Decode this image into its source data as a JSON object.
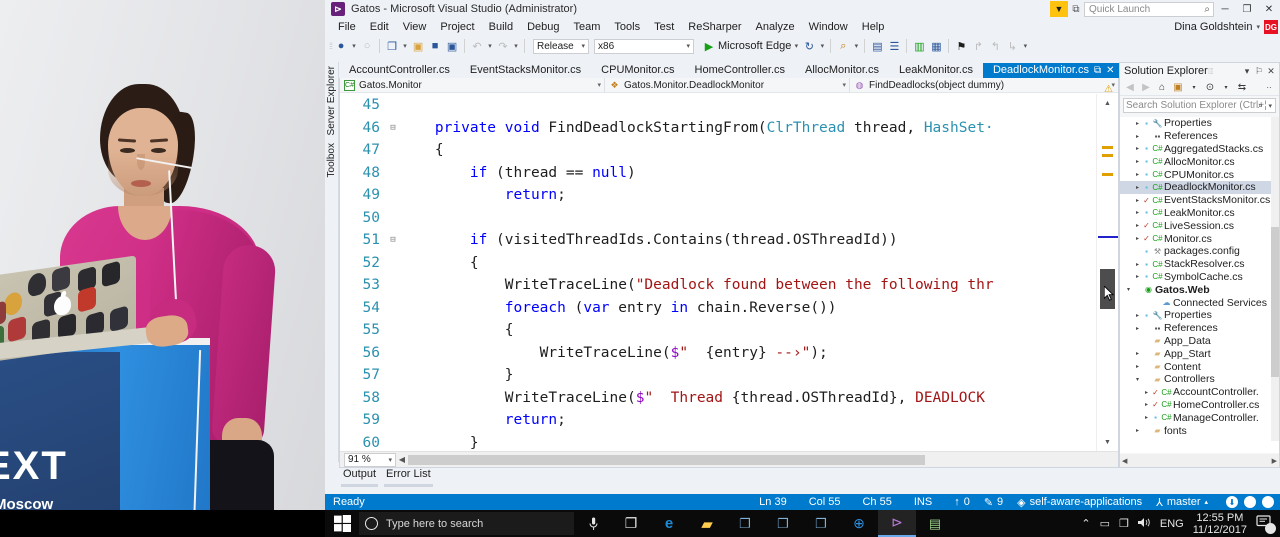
{
  "video": {
    "name": "conference-video-feed",
    "podium_text": "EXT",
    "podium_sub": "Moscow",
    "podium_chev": "/"
  },
  "window": {
    "title": "Gatos - Microsoft Visual Studio (Administrator)",
    "logo_glyph": "⊳",
    "minimize": "─",
    "restore": "❐",
    "close": "✕",
    "feedback_icon": "feedback-icon",
    "feedback_glyph": "▼",
    "screenshot_glyph": "⧉"
  },
  "quick_launch": {
    "placeholder": "Quick Launch",
    "magnifier": "⌕"
  },
  "menu": {
    "items": [
      "File",
      "Edit",
      "View",
      "Project",
      "Build",
      "Debug",
      "Team",
      "Tools",
      "Test",
      "ReSharper",
      "Analyze",
      "Window",
      "Help"
    ]
  },
  "user": {
    "name": "Dina Goldshtein",
    "caret": "▾",
    "initials": "DG"
  },
  "toolbar": {
    "navigate_back": "●",
    "navigate_forward": "○",
    "new_project": "❐",
    "open_file": "▣",
    "save": "■",
    "save_all": "▣",
    "undo": "↶",
    "redo": "↷",
    "config": "Release",
    "platform": "x86",
    "start_glyph": "▶",
    "start_label": "Microsoft Edge",
    "refresh": "↻",
    "caret": "▾",
    "find_glyph": "⌕",
    "extra_icons": [
      "▤",
      "☰",
      "▥",
      "▦",
      "⚑",
      "↱",
      "↰",
      "↳"
    ]
  },
  "side_tabs": [
    "Server Explorer",
    "Toolbox"
  ],
  "document_tabs": [
    {
      "label": "AccountController.cs",
      "active": false
    },
    {
      "label": "EventStacksMonitor.cs",
      "active": false
    },
    {
      "label": "CPUMonitor.cs",
      "active": false
    },
    {
      "label": "HomeController.cs",
      "active": false
    },
    {
      "label": "AllocMonitor.cs",
      "active": false
    },
    {
      "label": "LeakMonitor.cs",
      "active": false
    },
    {
      "label": "DeadlockMonitor.cs",
      "active": true
    }
  ],
  "tab_overflow_glyph": "☰",
  "tab_pin_glyph": "⧉",
  "tab_close_glyph": "✕",
  "navbar": {
    "project": "Gatos.Monitor",
    "type": "Gatos.Monitor.DeadlockMonitor",
    "member": "FindDeadlocks(object dummy)",
    "caret": "▾"
  },
  "code": {
    "lines": [
      {
        "num": "45",
        "glyph": "",
        "tokens": []
      },
      {
        "num": "46",
        "glyph": "⊟",
        "tokens": [
          {
            "t": "    ",
            "c": "n"
          },
          {
            "t": "private",
            "c": "k"
          },
          {
            "t": " ",
            "c": "n"
          },
          {
            "t": "void",
            "c": "k"
          },
          {
            "t": " FindDeadlockStartingFrom(",
            "c": "n"
          },
          {
            "t": "ClrThread",
            "c": "t"
          },
          {
            "t": " thread, ",
            "c": "n"
          },
          {
            "t": "HashSet·",
            "c": "t"
          }
        ]
      },
      {
        "num": "47",
        "glyph": "",
        "tokens": [
          {
            "t": "    {",
            "c": "n"
          }
        ]
      },
      {
        "num": "48",
        "glyph": "",
        "tokens": [
          {
            "t": "        ",
            "c": "n"
          },
          {
            "t": "if",
            "c": "k"
          },
          {
            "t": " (thread == ",
            "c": "n"
          },
          {
            "t": "null",
            "c": "k"
          },
          {
            "t": ")",
            "c": "n"
          }
        ]
      },
      {
        "num": "49",
        "glyph": "",
        "tokens": [
          {
            "t": "            ",
            "c": "n"
          },
          {
            "t": "return",
            "c": "k"
          },
          {
            "t": ";",
            "c": "n"
          }
        ]
      },
      {
        "num": "50",
        "glyph": "",
        "tokens": []
      },
      {
        "num": "51",
        "glyph": "⊟",
        "tokens": [
          {
            "t": "        ",
            "c": "n"
          },
          {
            "t": "if",
            "c": "k"
          },
          {
            "t": " (visitedThreadIds.Contains(thread.OSThreadId))",
            "c": "n"
          }
        ]
      },
      {
        "num": "52",
        "glyph": "",
        "tokens": [
          {
            "t": "        {",
            "c": "n"
          }
        ]
      },
      {
        "num": "53",
        "glyph": "",
        "tokens": [
          {
            "t": "            WriteTraceLine(",
            "c": "n"
          },
          {
            "t": "\"Deadlock found between the following thr",
            "c": "s"
          }
        ]
      },
      {
        "num": "54",
        "glyph": "",
        "tokens": [
          {
            "t": "            ",
            "c": "n"
          },
          {
            "t": "foreach",
            "c": "k"
          },
          {
            "t": " (",
            "c": "n"
          },
          {
            "t": "var",
            "c": "k"
          },
          {
            "t": " entry ",
            "c": "n"
          },
          {
            "t": "in",
            "c": "k"
          },
          {
            "t": " chain.Reverse())",
            "c": "n"
          }
        ]
      },
      {
        "num": "55",
        "glyph": "",
        "tokens": [
          {
            "t": "            {",
            "c": "n"
          }
        ]
      },
      {
        "num": "56",
        "glyph": "",
        "tokens": [
          {
            "t": "                WriteTraceLine(",
            "c": "n"
          },
          {
            "t": "$",
            "c": "d"
          },
          {
            "t": "\"  ",
            "c": "s"
          },
          {
            "t": "{entry}",
            "c": "n"
          },
          {
            "t": " --›\"",
            "c": "s"
          },
          {
            "t": ");",
            "c": "n"
          }
        ]
      },
      {
        "num": "57",
        "glyph": "",
        "tokens": [
          {
            "t": "            }",
            "c": "n"
          }
        ]
      },
      {
        "num": "58",
        "glyph": "",
        "tokens": [
          {
            "t": "            WriteTraceLine(",
            "c": "n"
          },
          {
            "t": "$",
            "c": "d"
          },
          {
            "t": "\"  Thread ",
            "c": "s"
          },
          {
            "t": "{thread.OSThreadId}",
            "c": "n"
          },
          {
            "t": ", ",
            "c": "n"
          },
          {
            "t": "DEADLOCK",
            "c": "s"
          }
        ]
      },
      {
        "num": "59",
        "glyph": "",
        "tokens": [
          {
            "t": "            ",
            "c": "n"
          },
          {
            "t": "return",
            "c": "k"
          },
          {
            "t": ";",
            "c": "n"
          }
        ]
      },
      {
        "num": "60",
        "glyph": "",
        "tokens": [
          {
            "t": "        }",
            "c": "n"
          }
        ]
      }
    ]
  },
  "zoom": {
    "value": "91 %",
    "caret": "▾"
  },
  "bottom_tabs": [
    "Output",
    "Error List"
  ],
  "solution_explorer": {
    "title": "Solution Explorer",
    "caret": "▾",
    "pin": "⚐",
    "close": "✕",
    "toolbar_icons": [
      "◀",
      "▶",
      "⌂",
      "▣",
      "▾",
      "⊙",
      "▾",
      "⇆",
      "··"
    ],
    "search_placeholder": "Search Solution Explorer (Ctrl+¦",
    "search_magnifier": "⌕",
    "search_caret": "▾",
    "tree": [
      {
        "indent": 1,
        "arrow": "▸",
        "lock": "▪",
        "icon": "🔧",
        "icon_color": "#3a6ea5",
        "label": "Properties",
        "bold": false,
        "sel": false
      },
      {
        "indent": 1,
        "arrow": "▸",
        "lock": "",
        "icon": "▪▪",
        "icon_color": "#555",
        "label": "References",
        "bold": false,
        "sel": false
      },
      {
        "indent": 1,
        "arrow": "▸",
        "lock": "▪",
        "icon": "C#",
        "icon_color": "#16a016",
        "label": "AggregatedStacks.cs",
        "bold": false,
        "sel": false
      },
      {
        "indent": 1,
        "arrow": "▸",
        "lock": "▪",
        "icon": "C#",
        "icon_color": "#16a016",
        "label": "AllocMonitor.cs",
        "bold": false,
        "sel": false
      },
      {
        "indent": 1,
        "arrow": "▸",
        "lock": "▪",
        "icon": "C#",
        "icon_color": "#16a016",
        "label": "CPUMonitor.cs",
        "bold": false,
        "sel": false
      },
      {
        "indent": 1,
        "arrow": "▸",
        "lock": "▪",
        "icon": "C#",
        "icon_color": "#16a016",
        "label": "DeadlockMonitor.cs",
        "bold": false,
        "sel": true
      },
      {
        "indent": 1,
        "arrow": "▸",
        "lock": "✓",
        "icon": "C#",
        "icon_color": "#16a016",
        "label": "EventStacksMonitor.cs",
        "bold": false,
        "sel": false
      },
      {
        "indent": 1,
        "arrow": "▸",
        "lock": "▪",
        "icon": "C#",
        "icon_color": "#16a016",
        "label": "LeakMonitor.cs",
        "bold": false,
        "sel": false
      },
      {
        "indent": 1,
        "arrow": "▸",
        "lock": "✓",
        "icon": "C#",
        "icon_color": "#16a016",
        "label": "LiveSession.cs",
        "bold": false,
        "sel": false
      },
      {
        "indent": 1,
        "arrow": "▸",
        "lock": "✓",
        "icon": "C#",
        "icon_color": "#16a016",
        "label": "Monitor.cs",
        "bold": false,
        "sel": false
      },
      {
        "indent": 1,
        "arrow": "",
        "lock": "▪",
        "icon": "⚒",
        "icon_color": "#888",
        "label": "packages.config",
        "bold": false,
        "sel": false
      },
      {
        "indent": 1,
        "arrow": "▸",
        "lock": "▪",
        "icon": "C#",
        "icon_color": "#16a016",
        "label": "StackResolver.cs",
        "bold": false,
        "sel": false
      },
      {
        "indent": 1,
        "arrow": "▸",
        "lock": "▪",
        "icon": "C#",
        "icon_color": "#16a016",
        "label": "SymbolCache.cs",
        "bold": false,
        "sel": false
      },
      {
        "indent": 0,
        "arrow": "▾",
        "lock": "",
        "icon": "◉",
        "icon_color": "#16a016",
        "label": "Gatos.Web",
        "bold": true,
        "sel": false
      },
      {
        "indent": 2,
        "arrow": "",
        "lock": "",
        "icon": "☁",
        "icon_color": "#5a9bd5",
        "label": "Connected Services",
        "bold": false,
        "sel": false
      },
      {
        "indent": 1,
        "arrow": "▸",
        "lock": "▪",
        "icon": "🔧",
        "icon_color": "#3a6ea5",
        "label": "Properties",
        "bold": false,
        "sel": false
      },
      {
        "indent": 1,
        "arrow": "▸",
        "lock": "",
        "icon": "▪▪",
        "icon_color": "#555",
        "label": "References",
        "bold": false,
        "sel": false
      },
      {
        "indent": 1,
        "arrow": "",
        "lock": "",
        "icon": "▰",
        "icon_color": "#dcb67a",
        "label": "App_Data",
        "bold": false,
        "sel": false
      },
      {
        "indent": 1,
        "arrow": "▸",
        "lock": "",
        "icon": "▰",
        "icon_color": "#dcb67a",
        "label": "App_Start",
        "bold": false,
        "sel": false
      },
      {
        "indent": 1,
        "arrow": "▸",
        "lock": "",
        "icon": "▰",
        "icon_color": "#dcb67a",
        "label": "Content",
        "bold": false,
        "sel": false
      },
      {
        "indent": 1,
        "arrow": "▾",
        "lock": "",
        "icon": "▰",
        "icon_color": "#dcb67a",
        "label": "Controllers",
        "bold": false,
        "sel": false
      },
      {
        "indent": 2,
        "arrow": "▸",
        "lock": "✓",
        "icon": "C#",
        "icon_color": "#16a016",
        "label": "AccountController.",
        "bold": false,
        "sel": false
      },
      {
        "indent": 2,
        "arrow": "▸",
        "lock": "✓",
        "icon": "C#",
        "icon_color": "#16a016",
        "label": "HomeController.cs",
        "bold": false,
        "sel": false
      },
      {
        "indent": 2,
        "arrow": "▸",
        "lock": "▪",
        "icon": "C#",
        "icon_color": "#16a016",
        "label": "ManageController.",
        "bold": false,
        "sel": false
      },
      {
        "indent": 1,
        "arrow": "▸",
        "lock": "",
        "icon": "▰",
        "icon_color": "#dcb67a",
        "label": "fonts",
        "bold": false,
        "sel": false
      }
    ],
    "hscroll_left": "◀",
    "hscroll_right": "▶"
  },
  "status_bar": {
    "ready": "Ready",
    "line": "Ln 39",
    "col": "Col 55",
    "ch": "Ch 55",
    "ins": "INS",
    "up_count": "0",
    "up_glyph": "↑",
    "pencil_count": "9",
    "pencil_glyph": "✎",
    "repo": "self-aware-applications",
    "repo_glyph": "◈",
    "branch": "master",
    "branch_glyph": "⅄",
    "branch_caret": "▴",
    "notify_glyph": "⬇"
  },
  "taskbar": {
    "start_glyph": "start-icon",
    "search_placeholder": "Type here to search",
    "mic_glyph": "⬤",
    "taskview_glyph": "❐",
    "apps": [
      {
        "name": "edge-icon",
        "glyph": "e",
        "color": "#1e8ad6"
      },
      {
        "name": "file-explorer-icon",
        "glyph": "▰",
        "color": "#ffcc4d"
      },
      {
        "name": "remote-desktop-icon",
        "glyph": "❐",
        "color": "#7fb0d8"
      },
      {
        "name": "remote-desktop-icon-2",
        "glyph": "❐",
        "color": "#7fb0d8"
      },
      {
        "name": "remote-desktop-icon-3",
        "glyph": "❐",
        "color": "#7fb0d8"
      },
      {
        "name": "safari-icon",
        "glyph": "⊕",
        "color": "#2e8fe0"
      },
      {
        "name": "visual-studio-icon",
        "glyph": "⊳",
        "color": "#9b5ec4"
      },
      {
        "name": "perfview-icon",
        "glyph": "▤",
        "color": "#9ad18a"
      }
    ],
    "tray": {
      "chevron": "⌃",
      "battery": "▭",
      "network": "❐",
      "volume": "ᴘ",
      "lang": "ENG",
      "time": "12:55 PM",
      "date": "11/12/2017",
      "notif_glyph": "▤",
      "notif_count": "2"
    }
  }
}
